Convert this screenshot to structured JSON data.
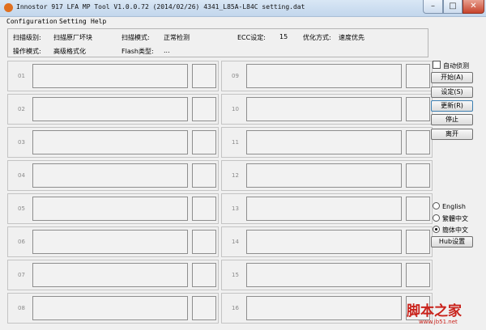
{
  "window": {
    "title": "Innostor 917 LFA MP Tool V1.0.0.72 (2014/02/26)   4341_L85A-L84C  setting.dat",
    "min_symbol": "–",
    "max_symbol": "□",
    "close_symbol": "✕"
  },
  "menu": [
    "Configuration",
    "Setting",
    "Help"
  ],
  "info": {
    "scan_level_label": "扫描级别:",
    "scan_level_value": "扫描原厂坏块",
    "scan_mode_label": "扫描模式:",
    "scan_mode_value": "正常检测",
    "ecc_label": "ECC设定:",
    "ecc_value": "15",
    "optimize_label": "优化方式:",
    "optimize_value": "速度优先",
    "op_mode_label": "操作模式:",
    "op_mode_value": "高级格式化",
    "flash_label": "Flash类型:",
    "flash_value": "..."
  },
  "slots_left": [
    "01",
    "02",
    "03",
    "04",
    "05",
    "06",
    "07",
    "08"
  ],
  "slots_right": [
    "09",
    "10",
    "11",
    "12",
    "13",
    "14",
    "15",
    "16"
  ],
  "controls": {
    "auto_detect": "自动侦测",
    "start": "开始(A)",
    "settings": "设定(S)",
    "update": "更新(R)",
    "stop": "停止",
    "exit": "离开"
  },
  "language": {
    "english": "English",
    "traditional": "繁體中文",
    "simplified": "簡体中文",
    "selected": "simplified"
  },
  "hub_button": "Hub设置",
  "watermark": {
    "main": "脚本之家",
    "sub": "www.jb51.net"
  }
}
